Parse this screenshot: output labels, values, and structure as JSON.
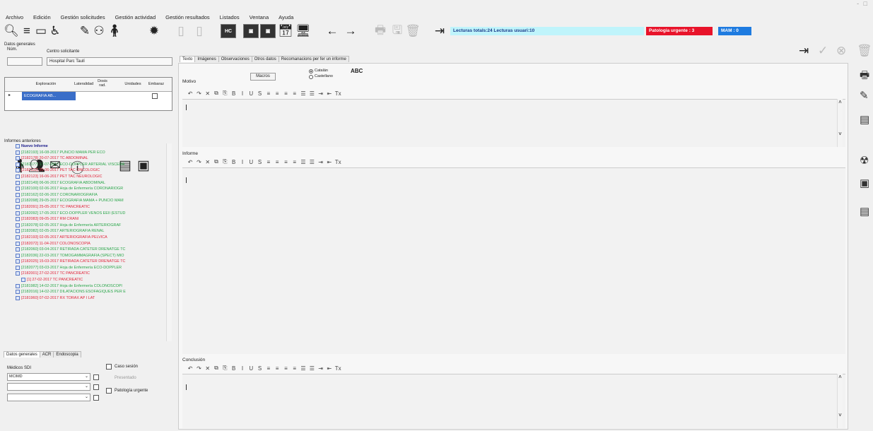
{
  "window_controls": "- □",
  "menu": [
    "Archivo",
    "Edición",
    "Gestión solicitudes",
    "Gestión actividad",
    "Gestión resultados",
    "Listados",
    "Ventana",
    "Ayuda"
  ],
  "toolbar": {
    "hc_label": "HC",
    "lecturas": "Lecturas totals:24 Lecturas usuari:10",
    "patologia": "Patologia urgente : 3",
    "mam": "MAM : 0",
    "status_colors": {
      "lecturas": "#bff4fb",
      "patologia": "#e8132a",
      "mam": "#1e7be0"
    }
  },
  "datos": {
    "section": "Datos generales",
    "num_label": "Núm.",
    "num_value": "",
    "centro_label": "Centro solicitante",
    "centro_value": "Hospital Parc Taulí"
  },
  "grid": {
    "headers": [
      "Exploración",
      "Lateralidad",
      "Dosis rad.",
      "Unidades",
      "Embaraz"
    ],
    "row": {
      "marker": "▸",
      "exploracion": "ECOGRAFIA AB..."
    }
  },
  "tree": {
    "title": "Informes anteriores",
    "items": [
      {
        "t": "Nuevo Informe",
        "c": "b"
      },
      {
        "t": "[2182193] 16-08-2017 PUNCIO MAMA PER ECO",
        "c": "g"
      },
      {
        "t": "[2182178] 20-07-2017 TC ABDOMINAL",
        "c": "r"
      },
      {
        "t": "[2182177] 17-07-2017 ECO-DOPPLER ARTERIAL VISCERA",
        "c": "g"
      },
      {
        "t": "[2182132] 20-06-2017 PET TAC ONCOLOGIC",
        "c": "r"
      },
      {
        "t": "[2182123] 16-06-2017 PET TAC NEUROLOGIC",
        "c": "r"
      },
      {
        "t": "[2182149] 06-06-2017 ECOGRAFIA ABDOMINAL",
        "c": "g"
      },
      {
        "t": "[2182100] 02-06-2017 Hoja de Enfermería CORONARIOGR",
        "c": "g"
      },
      {
        "t": "[2182162] 02-06-2017 CORONARIOGRAFIA",
        "c": "g"
      },
      {
        "t": "[2182098] 29-05-2017 ECOGRAFIA MAMA + PUNCIO MAM",
        "c": "g"
      },
      {
        "t": "[2182091] 25-05-2017 TC PANCREATIC",
        "c": "r"
      },
      {
        "t": "[2182092] 17-05-2017 ECO-DOPPLER VENOS EEII (ESTUD",
        "c": "g"
      },
      {
        "t": "[2182083] 09-05-2017 RM CRANI",
        "c": "r"
      },
      {
        "t": "[2182078] 02-05-2017 Hoja de Enfermería ARTERIOGRAF",
        "c": "g"
      },
      {
        "t": "[2182082] 02-05-2017 ARTERIOGRAFIA RENAL",
        "c": "g"
      },
      {
        "t": "[2182193] 02-05-2017 ARTERIOGRAFIA PELVICA",
        "c": "r"
      },
      {
        "t": "[2182072] 11-04-2017 COLONOSCOPIA",
        "c": "r"
      },
      {
        "t": "[2182060] 03-04-2017 RETIRADA CATETER DRENATGE TC",
        "c": "g"
      },
      {
        "t": "[2182036] 22-03-2017 TOMOGAMMAGRAFIA (SPECT) MIO",
        "c": "g"
      },
      {
        "t": "[2182025] 15-03-2017 RETIRADA CATETER DRENATGE TC",
        "c": "r"
      },
      {
        "t": "[2182077] 03-03-2017 Hoja de Enfermería ECO-DOPPLER",
        "c": "g"
      },
      {
        "t": "[2182001] 27-02-2017 TC PANCREATIC",
        "c": "r"
      },
      {
        "t": "[1] 27-02-2017 TC PANCREATIC",
        "c": "r",
        "k": true
      },
      {
        "t": "[2181982] 14-02-2017 Hoja de Enfermería COLONOSCOPI",
        "c": "g"
      },
      {
        "t": "[2182016] 14-02-2017 DILATACIONS ESOFAGIQUES PER E",
        "c": "g"
      },
      {
        "t": "[2181960] 07-02-2017 RX TORAX AP I LAT",
        "c": "r"
      }
    ]
  },
  "bottom_tabs": [
    "Datos generales",
    "ACR",
    "Endoscopia"
  ],
  "bottom": {
    "medicos_label": "Médicos SDI",
    "medico1": "MCIMD",
    "caso": "Caso sesión",
    "presentado": "Presentado",
    "patologia": "Patología urgente"
  },
  "main_tabs": [
    "Texto",
    "Imágenes",
    "Observaciones",
    "Otros datos",
    "Recomanacions per fer un informe"
  ],
  "motivo": {
    "label": "Motivo",
    "macros": "Macros",
    "lang1": "Catalán",
    "lang2": "Castellano",
    "abc": "ABC"
  },
  "informe_label": "Informe",
  "conclusion_label": "Conclusión",
  "editor_toolbar": [
    "↶",
    "↷",
    "✕",
    "⧉",
    "⎘",
    "B",
    "I",
    "U",
    "S",
    "≡",
    "≡",
    "≡",
    "≡",
    "☰",
    "☰",
    "⇥",
    "⇤",
    "Tx"
  ]
}
